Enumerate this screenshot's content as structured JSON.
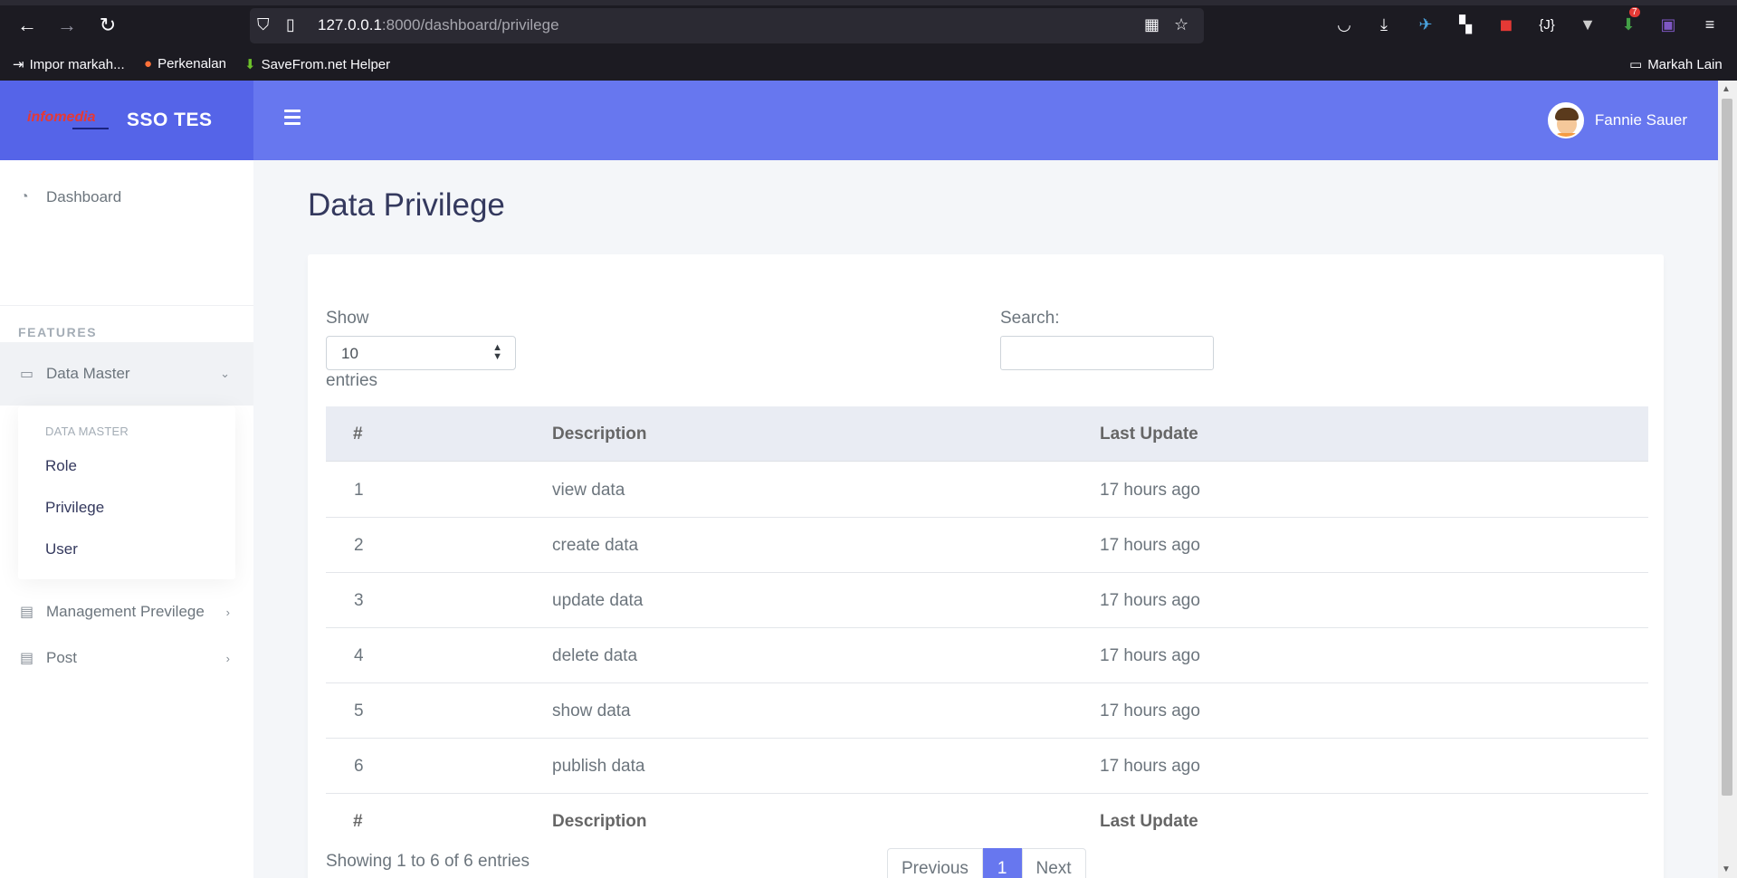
{
  "browser": {
    "url_host": "127.0.0.1",
    "url_rest": ":8000/dashboard/privilege",
    "bookmarks": [
      "Impor markah...",
      "Perkenalan",
      "SaveFrom.net Helper"
    ],
    "other_bookmarks": "Markah Lain",
    "badge_count": "7"
  },
  "app": {
    "logo_text": "infomedia",
    "brand_name": "SSO TES",
    "user_name": "Fannie Sauer"
  },
  "sidebar": {
    "dashboard": "Dashboard",
    "header": "FEATURES",
    "data_master": "Data Master",
    "dropdown_header": "DATA MASTER",
    "sub_items": [
      "Role",
      "Privilege",
      "User"
    ],
    "management": "Management Previlege",
    "post": "Post"
  },
  "page": {
    "title": "Data Privilege",
    "show_label": "Show",
    "entries_value": "10",
    "entries_label": "entries",
    "search_label": "Search:",
    "columns": [
      "#",
      "Description",
      "Last Update"
    ],
    "rows": [
      [
        "1",
        "view data",
        "17 hours ago"
      ],
      [
        "2",
        "create data",
        "17 hours ago"
      ],
      [
        "3",
        "update data",
        "17 hours ago"
      ],
      [
        "4",
        "delete data",
        "17 hours ago"
      ],
      [
        "5",
        "show data",
        "17 hours ago"
      ],
      [
        "6",
        "publish data",
        "17 hours ago"
      ]
    ],
    "info": "Showing 1 to 6 of 6 entries",
    "pager": {
      "previous": "Previous",
      "current": "1",
      "next": "Next"
    }
  },
  "colors": {
    "navbar": "#6777ef",
    "brand": "#5564e8",
    "accent": "#6777ef"
  }
}
